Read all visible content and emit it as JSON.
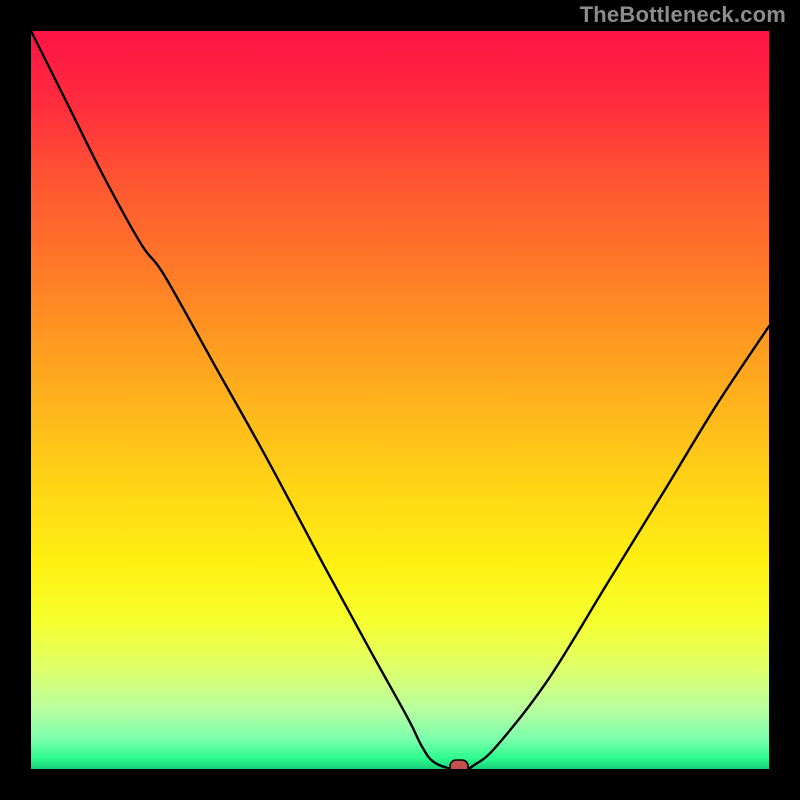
{
  "watermark": "TheBottleneck.com",
  "chart_data": {
    "type": "line",
    "title": "",
    "xlabel": "",
    "ylabel": "",
    "xlim": [
      0,
      100
    ],
    "ylim": [
      0,
      100
    ],
    "grid": false,
    "legend": false,
    "background": "rainbow-gradient",
    "series": [
      {
        "name": "bottleneck-curve",
        "description": "V-shaped bottleneck curve dropping from top-left to a minimum near x≈58 then rising to the right edge",
        "x": [
          0,
          5,
          10,
          15,
          18,
          25,
          32,
          40,
          46,
          51,
          53,
          54.5,
          57,
          59,
          60,
          63,
          70,
          78,
          86,
          93,
          100
        ],
        "y": [
          100,
          90,
          80,
          71,
          67,
          54.5,
          42,
          27,
          16,
          7,
          3,
          1,
          0,
          0,
          0.5,
          3,
          12,
          25,
          38,
          49.5,
          60
        ]
      }
    ],
    "marker": {
      "name": "optimal-point",
      "x": 58,
      "y": 0,
      "shape": "rounded-rect",
      "color": "#c6504f"
    }
  }
}
